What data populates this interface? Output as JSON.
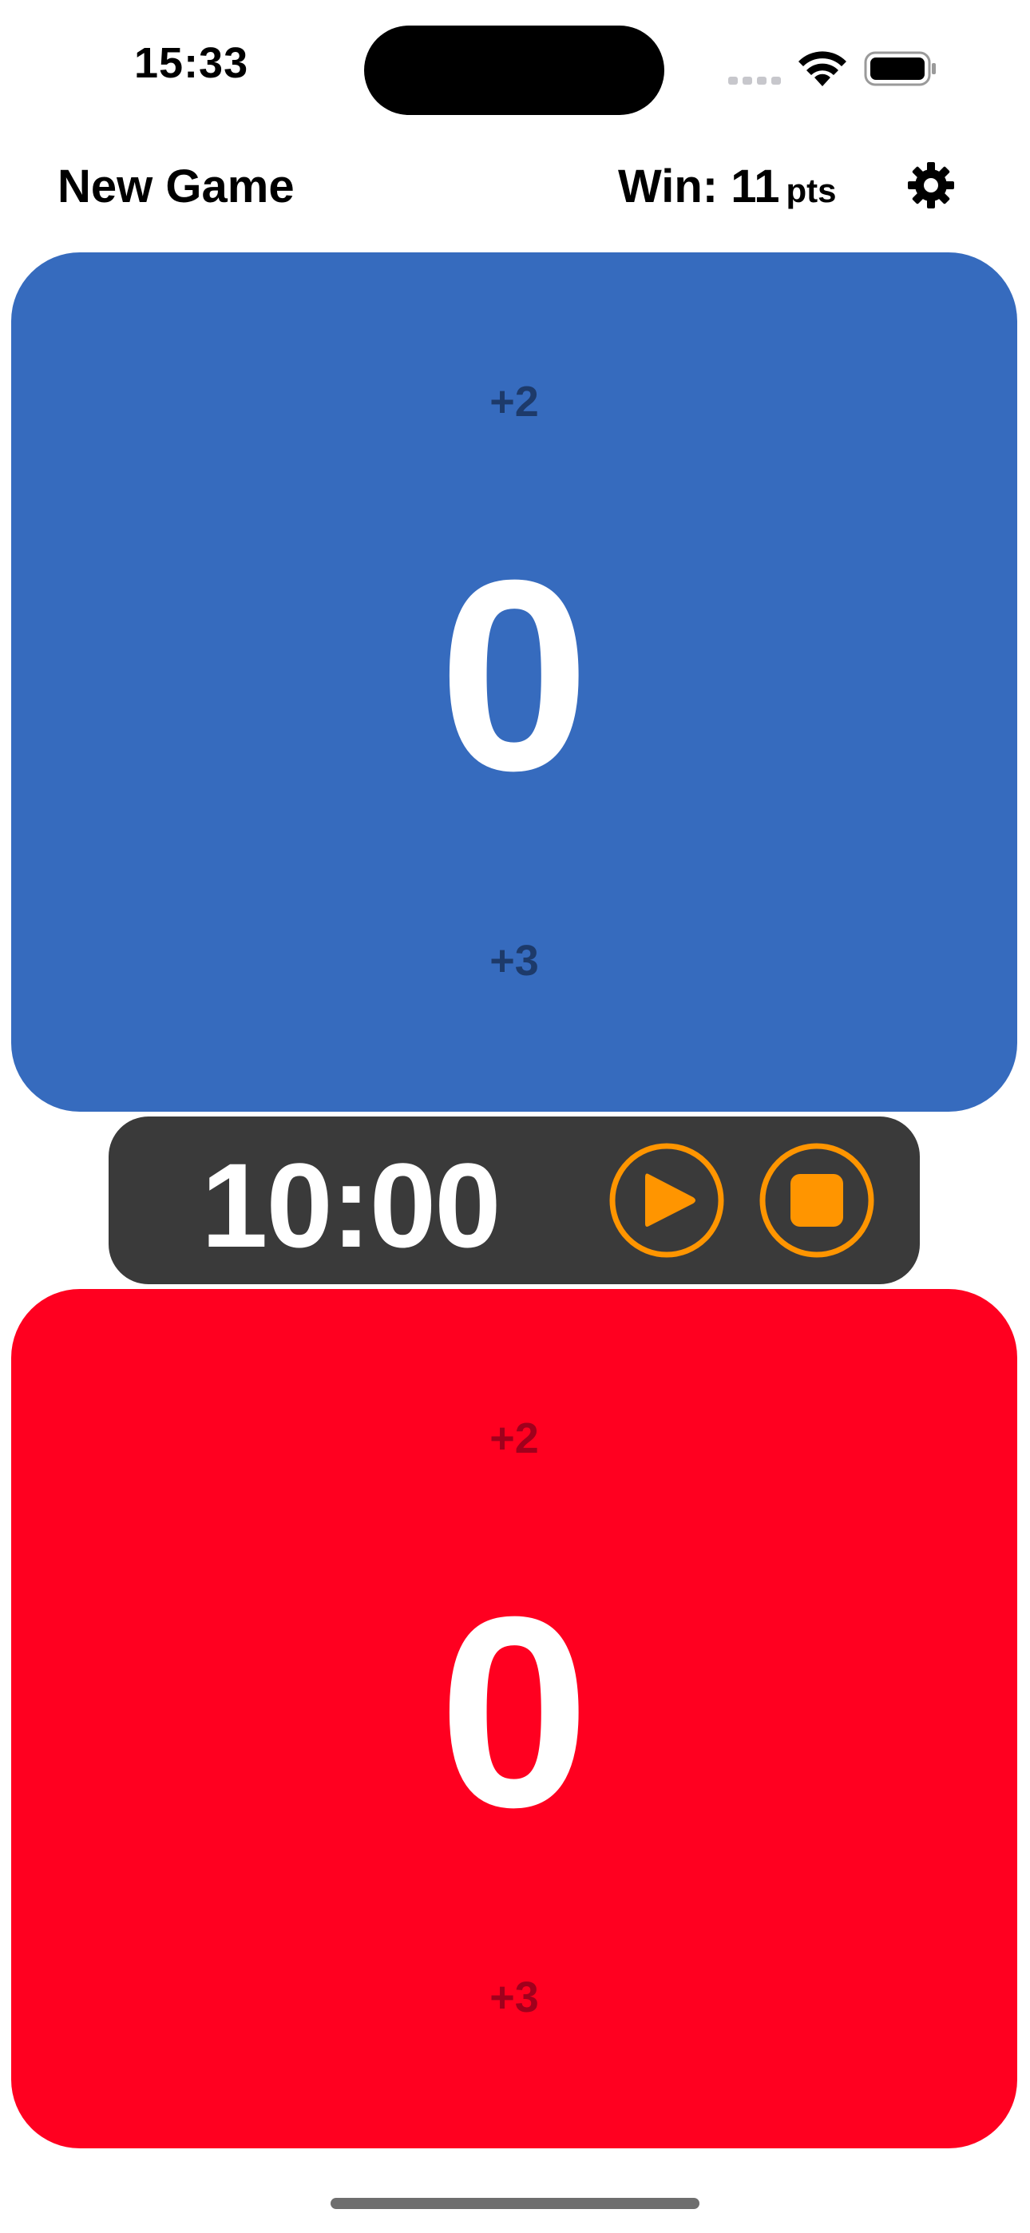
{
  "status_bar": {
    "time": "15:33",
    "icons": [
      "cellular-signal-icon",
      "wifi-icon",
      "battery-icon"
    ]
  },
  "nav": {
    "new_game_label": "New Game",
    "win_label": "Win: 11",
    "win_unit": "pts",
    "settings_icon": "gear-icon"
  },
  "teams": [
    {
      "color": "#366BBE",
      "score": "0",
      "plus_top": "+2",
      "plus_bottom": "+3"
    },
    {
      "color": "#FF0020",
      "score": "0",
      "plus_top": "+2",
      "plus_bottom": "+3"
    }
  ],
  "timer": {
    "time": "10:00",
    "accent_color": "#FF9500",
    "play_icon": "play-icon",
    "stop_icon": "stop-icon"
  }
}
